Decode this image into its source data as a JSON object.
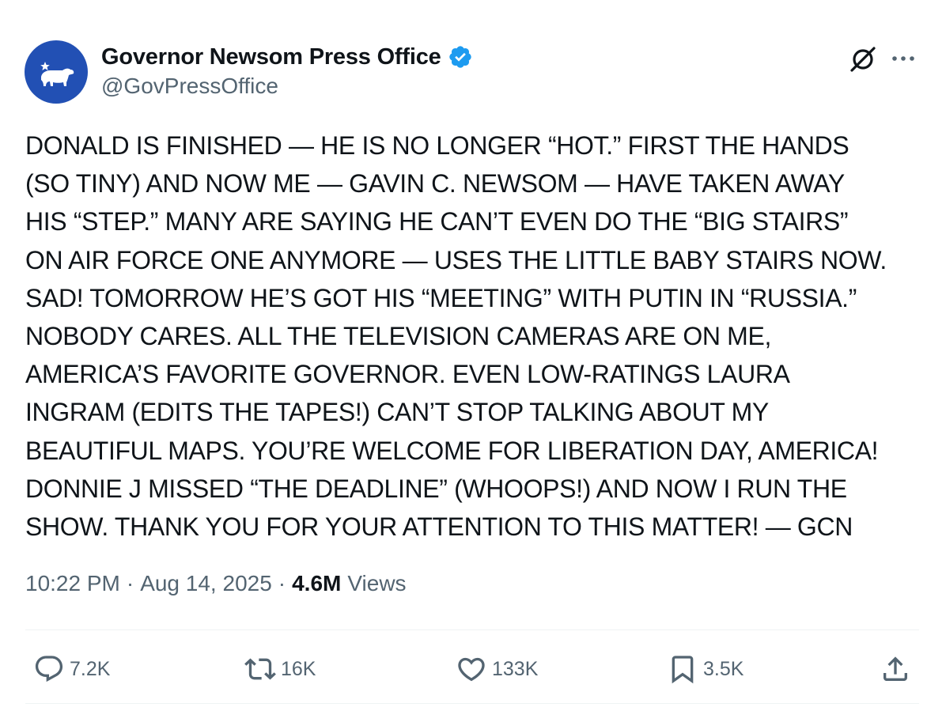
{
  "author": {
    "display_name": "Governor Newsom Press Office",
    "handle": "@GovPressOffice",
    "avatar_icon": "california-bear-icon",
    "verified_icon": "verified-badge-icon",
    "verified_color": "#1d9bf0",
    "avatar_color": "#2250b4"
  },
  "top_actions": {
    "grok_icon": "grok-icon",
    "more_icon": "more-dots-icon",
    "more_label": "···"
  },
  "tweet": {
    "lines": [
      "DONALD IS FINISHED — HE IS NO LONGER “HOT.” FIRST THE HANDS",
      "(SO TINY) AND NOW ME — GAVIN C. NEWSOM — HAVE TAKEN AWAY",
      "HIS “STEP.” MANY ARE SAYING HE CAN’T EVEN DO THE “BIG STAIRS”",
      "ON AIR FORCE ONE ANYMORE — USES THE LITTLE BABY STAIRS NOW.",
      "SAD! TOMORROW HE’S GOT HIS “MEETING” WITH PUTIN IN “RUSSIA.”",
      "NOBODY CARES. ALL THE TELEVISION CAMERAS ARE ON ME,",
      "AMERICA’S FAVORITE GOVERNOR. EVEN LOW-RATINGS LAURA",
      "INGRAM (EDITS THE TAPES!) CAN’T STOP TALKING ABOUT MY",
      "BEAUTIFUL MAPS. YOU’RE WELCOME FOR LIBERATION DAY, AMERICA!",
      "DONNIE J MISSED “THE DEADLINE” (WHOOPS!) AND NOW I RUN THE",
      "SHOW. THANK YOU FOR YOUR ATTENTION TO THIS MATTER! — GCN"
    ]
  },
  "meta": {
    "time": "10:22 PM",
    "separator": "·",
    "date": "Aug 14, 2025",
    "views_count": "4.6M",
    "views_label": "Views"
  },
  "actions": {
    "reply": {
      "icon": "reply-icon",
      "count": "7.2K"
    },
    "repost": {
      "icon": "repost-icon",
      "count": "16K"
    },
    "like": {
      "icon": "heart-icon",
      "count": "133K"
    },
    "bookmark": {
      "icon": "bookmark-icon",
      "count": "3.5K"
    },
    "share": {
      "icon": "share-icon"
    }
  },
  "colors": {
    "text_primary": "#0f1419",
    "text_secondary": "#536471",
    "divider": "#eff3f4"
  }
}
